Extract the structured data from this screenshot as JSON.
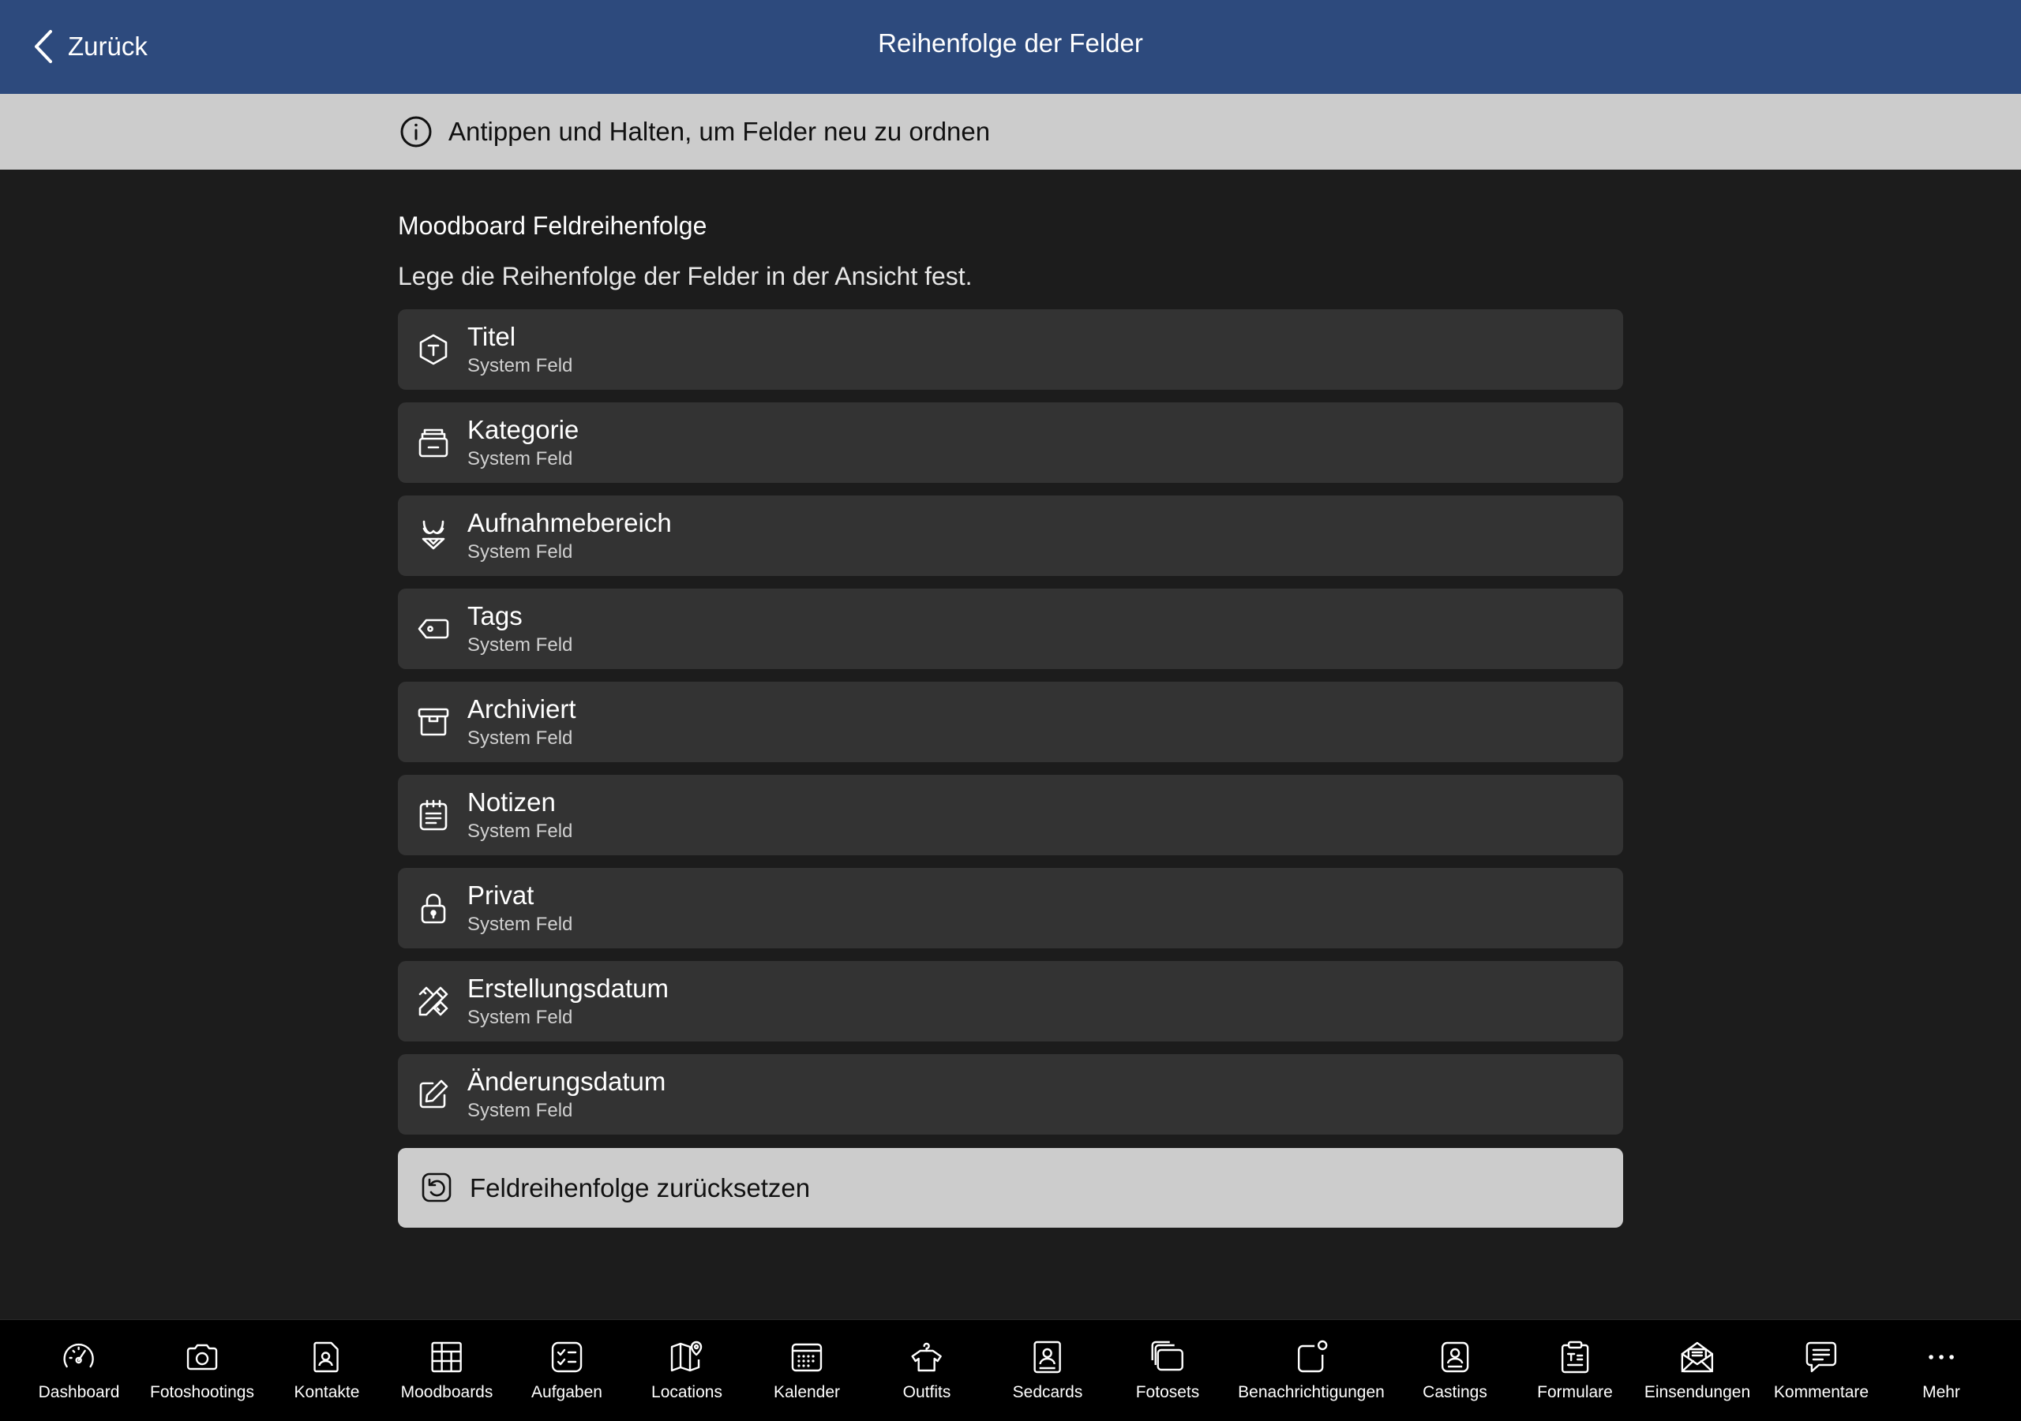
{
  "header": {
    "back_label": "Zurück",
    "title": "Reihenfolge der Felder",
    "background": "#2d4a7d"
  },
  "info_bar": {
    "icon": "info-icon",
    "text": "Antippen und Halten, um Felder neu zu ordnen"
  },
  "section": {
    "title": "Moodboard Feldreihenfolge",
    "description": "Lege die Reihenfolge der Felder in der Ansicht fest."
  },
  "fields": [
    {
      "title": "Titel",
      "subtitle": "System Feld",
      "icon": "title-icon"
    },
    {
      "title": "Kategorie",
      "subtitle": "System Feld",
      "icon": "category-icon"
    },
    {
      "title": "Aufnahmebereich",
      "subtitle": "System Feld",
      "icon": "bikini-icon"
    },
    {
      "title": "Tags",
      "subtitle": "System Feld",
      "icon": "tag-icon"
    },
    {
      "title": "Archiviert",
      "subtitle": "System Feld",
      "icon": "archive-icon"
    },
    {
      "title": "Notizen",
      "subtitle": "System Feld",
      "icon": "notes-icon"
    },
    {
      "title": "Privat",
      "subtitle": "System Feld",
      "icon": "lock-icon"
    },
    {
      "title": "Erstellungsdatum",
      "subtitle": "System Feld",
      "icon": "pencil-ruler-icon"
    },
    {
      "title": "Änderungsdatum",
      "subtitle": "System Feld",
      "icon": "edit-icon"
    }
  ],
  "reset_button": {
    "label": "Feldreihenfolge zurücksetzen",
    "icon": "reset-icon"
  },
  "tabbar": {
    "items": [
      {
        "label": "Dashboard",
        "icon": "gauge-icon"
      },
      {
        "label": "Fotoshootings",
        "icon": "camera-icon"
      },
      {
        "label": "Kontakte",
        "icon": "contact-icon"
      },
      {
        "label": "Moodboards",
        "icon": "moodboard-icon"
      },
      {
        "label": "Aufgaben",
        "icon": "tasks-icon"
      },
      {
        "label": "Locations",
        "icon": "map-icon"
      },
      {
        "label": "Kalender",
        "icon": "calendar-icon"
      },
      {
        "label": "Outfits",
        "icon": "outfit-icon"
      },
      {
        "label": "Sedcards",
        "icon": "sedcard-icon"
      },
      {
        "label": "Fotosets",
        "icon": "photosets-icon"
      },
      {
        "label": "Benachrichtigungen",
        "icon": "notification-icon"
      },
      {
        "label": "Castings",
        "icon": "casting-icon"
      },
      {
        "label": "Formulare",
        "icon": "form-icon"
      },
      {
        "label": "Einsendungen",
        "icon": "submission-icon"
      },
      {
        "label": "Kommentare",
        "icon": "comment-icon"
      },
      {
        "label": "Mehr",
        "icon": "more-icon"
      }
    ]
  }
}
